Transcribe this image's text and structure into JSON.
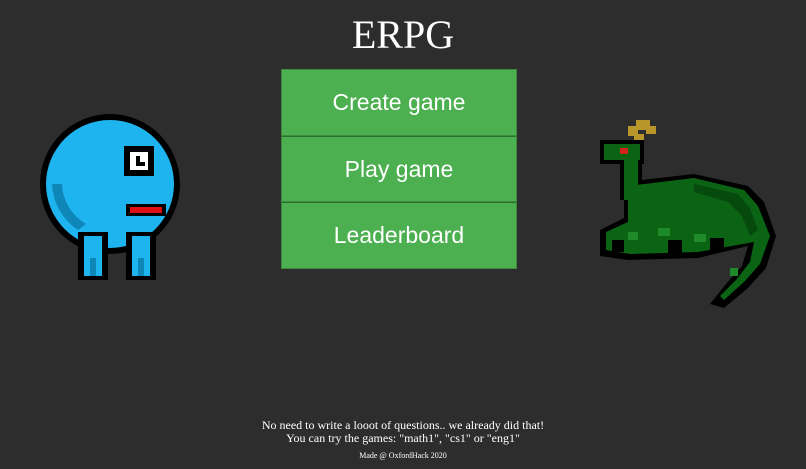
{
  "title": "ERPG",
  "menu": {
    "create_label": "Create game",
    "play_label": "Play game",
    "leaderboard_label": "Leaderboard"
  },
  "footer": {
    "line1": "No need to write a looot of questions.. we already did that!",
    "line2": "You can try the games: \"math1\", \"cs1\" or \"eng1\"",
    "credit": "Made @ OxfordHack 2020"
  },
  "colors": {
    "background": "#2d2d2d",
    "button": "#4caf50",
    "blob": "#1eb4f0",
    "dragon": "#0a6414"
  },
  "icons": {
    "left_sprite": "blue-blob-creature",
    "right_sprite": "green-dragon-creature"
  }
}
